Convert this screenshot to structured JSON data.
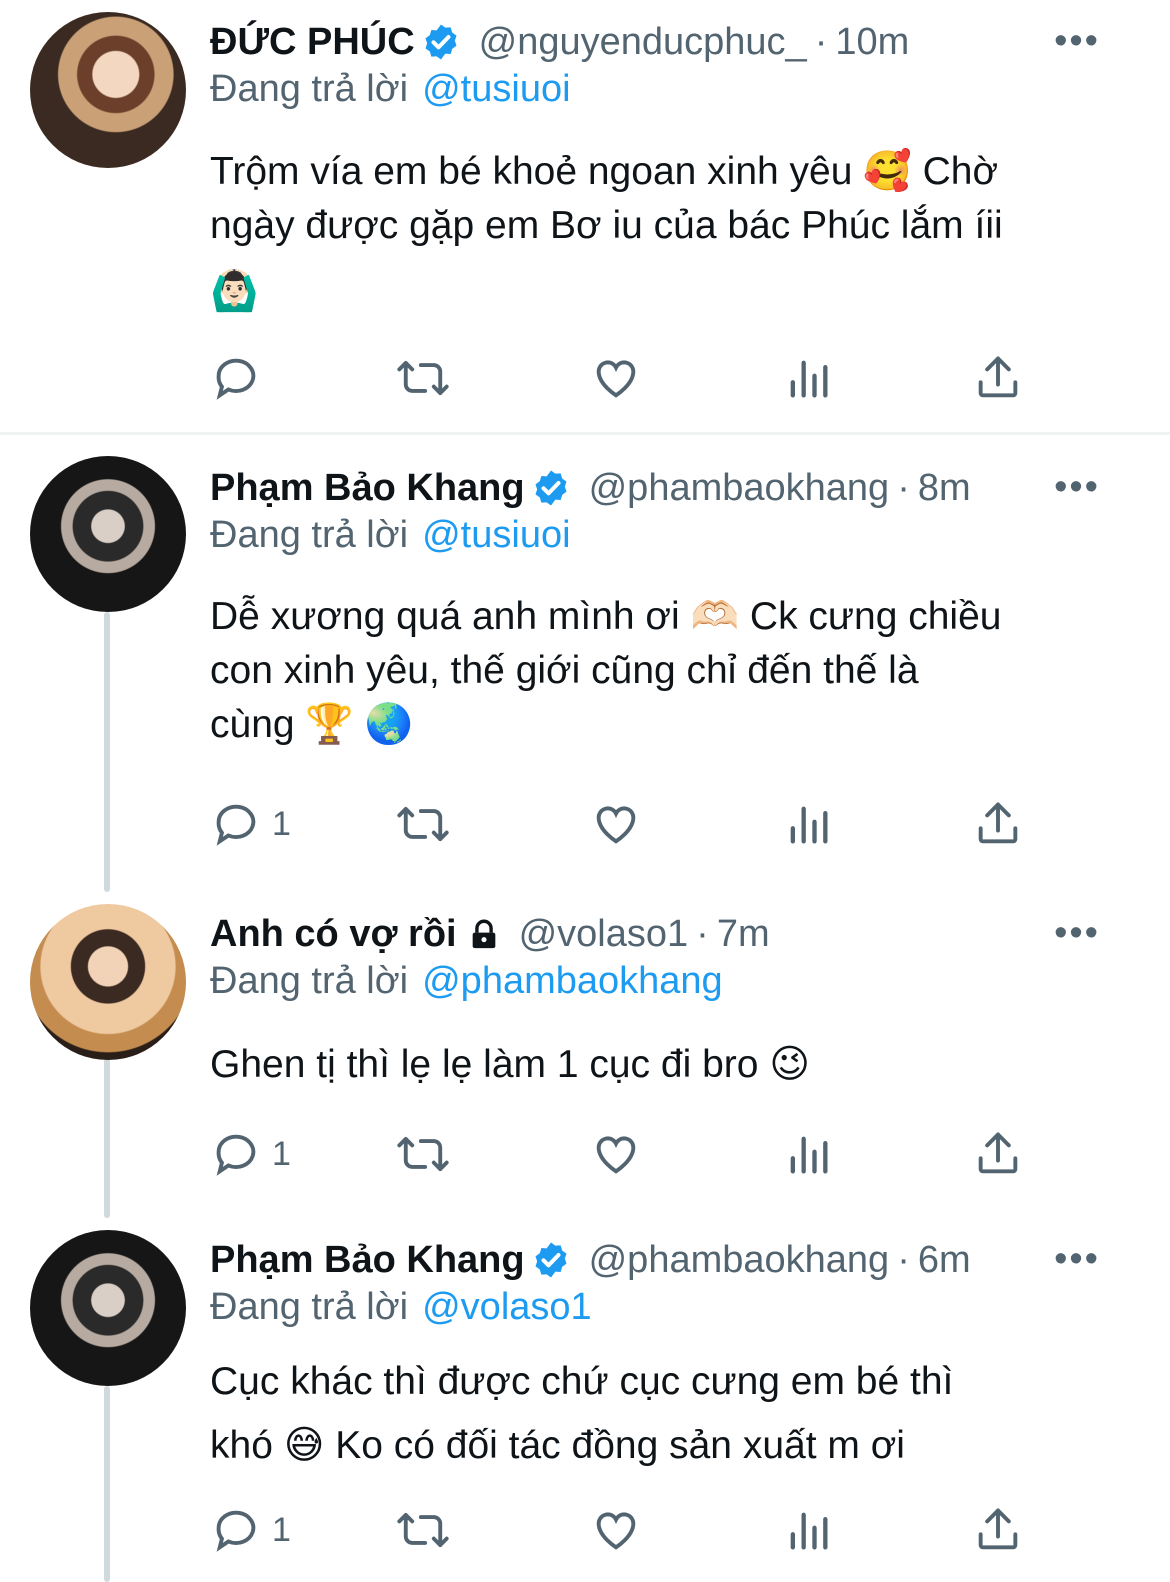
{
  "tweets": [
    {
      "name": "ĐỨC PHÚC",
      "handle": "@nguyenducphuc_",
      "dot": "·",
      "time": "10m",
      "reply_prefix": "Đang trả lời",
      "reply_to": "@tusiuoi",
      "text_line1": "Trộm vía em bé khoẻ ngoan xinh yêu 🥰  Chờ",
      "text_line2": "ngày được gặp em Bơ iu của bác Phúc lắm íii",
      "text_line3": "🙆🏻‍♂️",
      "reply_count": "",
      "more": "•••"
    },
    {
      "name": "Phạm Bảo Khang",
      "handle": "@phambaokhang",
      "dot": "·",
      "time": "8m",
      "reply_prefix": "Đang trả lời",
      "reply_to": "@tusiuoi",
      "text_line1": "Dễ xương quá anh mình ơi 🫶🏻 Ck cưng chiều",
      "text_line2": "con xinh yêu, thế giới cũng chỉ đến thế là",
      "text_line3": "cùng 🏆 🌏",
      "reply_count": "1",
      "more": "•••"
    },
    {
      "name": "Anh có vợ rồi",
      "handle": "@volaso1",
      "dot": "·",
      "time": "7m",
      "reply_prefix": "Đang trả lời",
      "reply_to": "@phambaokhang",
      "text_line1": "Ghen tị thì lẹ lẹ làm 1 cục đi bro 😉",
      "reply_count": "1",
      "more": "•••"
    },
    {
      "name": "Phạm Bảo Khang",
      "handle": "@phambaokhang",
      "dot": "·",
      "time": "6m",
      "reply_prefix": "Đang trả lời",
      "reply_to": "@volaso1",
      "text_line1": "Cục khác thì được chứ cục cưng em bé thì",
      "text_line2": "khó 😅 Ko có đối tác đồng sản xuất m ơi",
      "reply_count": "1",
      "more": "•••"
    }
  ],
  "colors": {
    "accent": "#1d9bf0",
    "muted": "#536471",
    "text": "#0f1419",
    "thread": "#cfd9de"
  },
  "icons": [
    "verified-badge-icon",
    "lock-icon",
    "reply-icon",
    "retweet-icon",
    "like-icon",
    "views-icon",
    "share-icon",
    "more-icon"
  ]
}
